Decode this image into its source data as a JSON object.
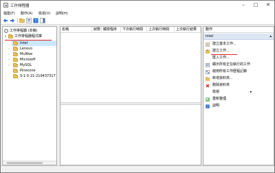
{
  "window": {
    "title": "工作排程器"
  },
  "menu": [
    "檔案(F)",
    "動作(A)",
    "檢視(V)",
    "說明(H)"
  ],
  "tree": {
    "root": "工作排程器 (本機)",
    "library": "工作排程器程式庫",
    "items": [
      "Intel",
      "Lenovo",
      "McAfee",
      "Microsoft",
      "MySQL",
      "Pinecone",
      "S-1-5-21-219437317"
    ]
  },
  "columns": [
    "名稱",
    "狀態",
    "觸發程序",
    "下次執行時間",
    "上次執行時間",
    "上次執行結果"
  ],
  "actions": {
    "pane_title": "動作",
    "section": "Intel",
    "items": [
      {
        "label": "建立基本工作...",
        "icon": "basic-task-icon"
      },
      {
        "label": "建立工作...",
        "icon": "create-task-icon"
      },
      {
        "label": "匯入工作...",
        "icon": "blank"
      },
      {
        "label": "顯示所有正在執行的工作",
        "icon": "running-tasks-icon"
      },
      {
        "label": "啟用所有工作歷程記錄",
        "icon": "history-icon"
      },
      {
        "label": "新增資料夾...",
        "icon": "new-folder-icon"
      },
      {
        "label": "刪除資料夾",
        "icon": "delete-icon"
      },
      {
        "label": "檢視",
        "icon": "blank"
      },
      {
        "label": "重新整理",
        "icon": "refresh-icon"
      },
      {
        "label": "說明",
        "icon": "help-icon"
      }
    ]
  },
  "colors": {
    "selection": "#cce8ff",
    "annotation": "#e02020"
  }
}
